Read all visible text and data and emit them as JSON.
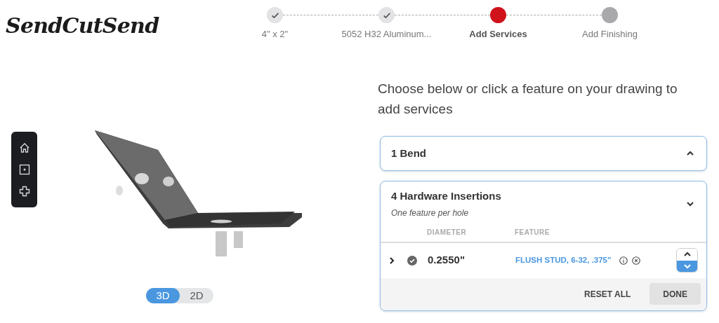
{
  "logo": "SendCutSend",
  "steps": [
    {
      "label": "4\" x 2\"",
      "completed": true,
      "selected": false
    },
    {
      "label": "5052 H32 Aluminum...",
      "completed": true,
      "selected": false
    },
    {
      "label": "Add Services",
      "completed": false,
      "selected": true
    },
    {
      "label": "Add Finishing",
      "completed": false,
      "selected": false
    }
  ],
  "view_toggle": [
    {
      "label": "3D",
      "selected": true
    },
    {
      "label": "2D",
      "selected": false
    }
  ],
  "prompt": "Choose below or click a feature on your drawing to add services",
  "sections": [
    {
      "title": "1 Bend",
      "expanded": false
    },
    {
      "title": "4 Hardware Insertions",
      "expanded": true,
      "subtitle": "One feature per hole",
      "columns": [
        "DIAMETER",
        "FEATURE"
      ],
      "rows": [
        {
          "diameter": "0.2550\"",
          "feature": "FLUSH STUD, 6-32, .375\""
        }
      ],
      "buttons": [
        "RESET ALL",
        "DONE"
      ]
    }
  ]
}
